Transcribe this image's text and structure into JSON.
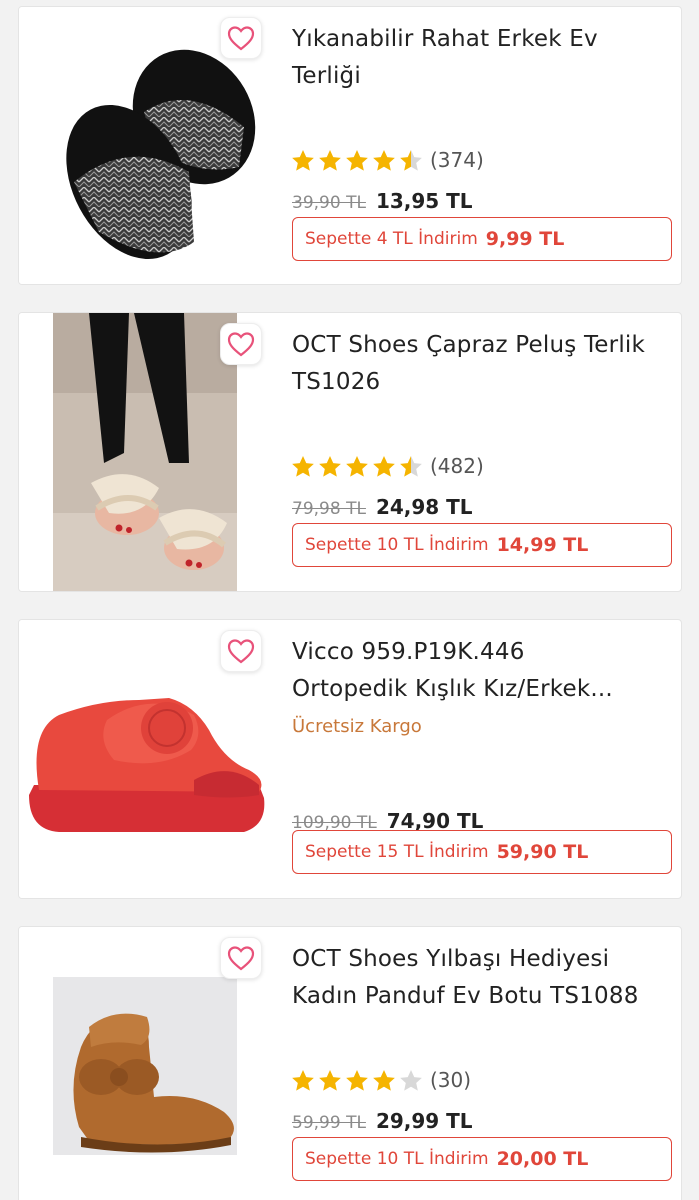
{
  "products": [
    {
      "title_line1": "Yıkanabilir Rahat Erkek Ev",
      "title_line2": "Terliği",
      "rating": 4.5,
      "review_count": "(374)",
      "old_price": "39,90 TL",
      "new_price": "13,95 TL",
      "basket_text": "Sepette 4 TL İndirim",
      "basket_price": "9,99 TL",
      "image_icon": "mens-slipper-image"
    },
    {
      "title_line1": "OCT Shoes Çapraz Peluş Terlik",
      "title_line2": "TS1026",
      "rating": 4.5,
      "review_count": "(482)",
      "old_price": "79,98 TL",
      "new_price": "24,98 TL",
      "basket_text": "Sepette 10 TL İndirim",
      "basket_price": "14,99 TL",
      "image_icon": "cross-plush-slipper-image"
    },
    {
      "title_line1": "Vicco 959.P19K.446",
      "title_line2": "Ortopedik Kışlık Kız/Erkek...",
      "badge": "Ücretsiz Kargo",
      "old_price": "109,90 TL",
      "new_price": "74,90 TL",
      "basket_text": "Sepette 15 TL İndirim",
      "basket_price": "59,90 TL",
      "image_icon": "red-kids-shoe-image"
    },
    {
      "title_line1": "OCT Shoes Yılbaşı Hediyesi",
      "title_line2": "Kadın Panduf Ev Botu TS1088",
      "rating": 4,
      "review_count": "(30)",
      "old_price": "59,99 TL",
      "new_price": "29,99 TL",
      "basket_text": "Sepette 10 TL İndirim",
      "basket_price": "20,00 TL",
      "image_icon": "plush-bootie-image"
    }
  ],
  "colors": {
    "accent": "#e0463a",
    "star": "#f5b400",
    "star_empty": "#d8d8d8",
    "heart": "#e8527a",
    "kargo": "#c8783a"
  }
}
